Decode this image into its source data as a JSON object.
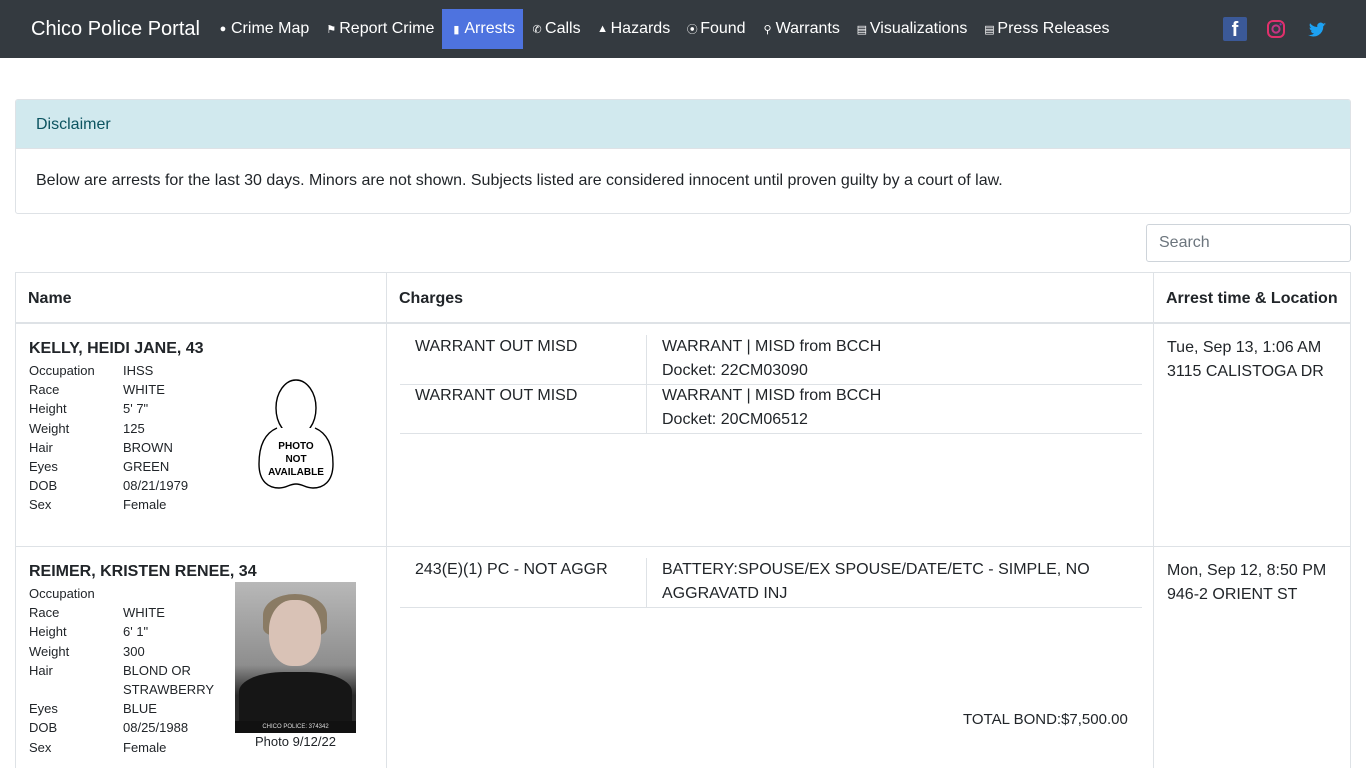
{
  "navbar": {
    "brand": "Chico Police Portal",
    "items": [
      {
        "label": "Crime Map",
        "icon": "map-marker-icon",
        "active": false
      },
      {
        "label": "Report Crime",
        "icon": "flag-icon",
        "active": false
      },
      {
        "label": "Arrests",
        "icon": "id-card-icon",
        "active": true
      },
      {
        "label": "Calls",
        "icon": "phone-icon",
        "active": false
      },
      {
        "label": "Hazards",
        "icon": "warning-icon",
        "active": false
      },
      {
        "label": "Found",
        "icon": "compass-icon",
        "active": false
      },
      {
        "label": "Warrants",
        "icon": "search-icon",
        "active": false
      },
      {
        "label": "Visualizations",
        "icon": "chart-icon",
        "active": false
      },
      {
        "label": "Press Releases",
        "icon": "newspaper-icon",
        "active": false
      }
    ],
    "social": [
      "facebook-icon",
      "instagram-icon",
      "twitter-icon"
    ]
  },
  "disclaimer": {
    "title": "Disclaimer",
    "text": "Below are arrests for the last 30 days. Minors are not shown. Subjects listed are considered innocent until proven guilty by a court of law."
  },
  "search": {
    "placeholder": "Search"
  },
  "table": {
    "headers": [
      "Name",
      "Charges",
      "Arrest time & Location"
    ],
    "rows": [
      {
        "name": "KELLY, HEIDI JANE, 43",
        "attributes": [
          {
            "key": "Occupation",
            "value": "IHSS"
          },
          {
            "key": "Race",
            "value": "WHITE"
          },
          {
            "key": "Height",
            "value": "5' 7\""
          },
          {
            "key": "Weight",
            "value": "125"
          },
          {
            "key": "Hair",
            "value": "BROWN"
          },
          {
            "key": "Eyes",
            "value": "GREEN"
          },
          {
            "key": "DOB",
            "value": "08/21/1979"
          },
          {
            "key": "Sex",
            "value": "Female"
          }
        ],
        "photo_placeholder": [
          "PHOTO",
          "NOT",
          "AVAILABLE"
        ],
        "charges": [
          {
            "code": "WARRANT OUT MISD",
            "desc": "WARRANT | MISD from BCCH",
            "docket": "Docket: 22CM03090"
          },
          {
            "code": "WARRANT OUT MISD",
            "desc": "WARRANT | MISD from BCCH",
            "docket": "Docket: 20CM06512"
          }
        ],
        "time": "Tue, Sep 13, 1:06 AM",
        "location": "3115 CALISTOGA DR"
      },
      {
        "name": "REIMER, KRISTEN RENEE, 34",
        "attributes": [
          {
            "key": "Occupation",
            "value": ""
          },
          {
            "key": "Race",
            "value": "WHITE"
          },
          {
            "key": "Height",
            "value": "6' 1\""
          },
          {
            "key": "Weight",
            "value": "300"
          },
          {
            "key": "Hair",
            "value": "BLOND OR STRAWBERRY"
          },
          {
            "key": "Eyes",
            "value": "BLUE"
          },
          {
            "key": "DOB",
            "value": "08/25/1988"
          },
          {
            "key": "Sex",
            "value": "Female"
          }
        ],
        "photo_caption": "Photo 9/12/22",
        "photo_bar_text": "CHICO POLICE: 374342",
        "charges": [
          {
            "code": "243(E)(1) PC - NOT AGGR",
            "desc": "BATTERY:SPOUSE/EX SPOUSE/DATE/ETC - SIMPLE, NO AGGRAVATD INJ"
          }
        ],
        "time": "Mon, Sep 12, 8:50 PM",
        "location": "946-2 ORIENT ST",
        "total_bond": "TOTAL BOND:$7,500.00"
      }
    ]
  }
}
